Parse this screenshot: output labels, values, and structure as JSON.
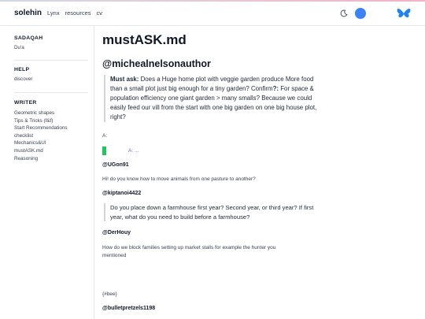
{
  "nav": {
    "brand": "solehin",
    "links": [
      "Lynx",
      "resources",
      "cv"
    ],
    "icons": {
      "theme": "moon-icon",
      "bluesky": "bluesky-avatar",
      "butterfly": "bluesky-butterfly-icon"
    },
    "accent": "#3b82f6"
  },
  "sidebar": {
    "sections": [
      {
        "title": "SADAQAH",
        "items": [
          "Du'a"
        ]
      },
      {
        "title": "HELP",
        "items": [
          "discover"
        ]
      },
      {
        "title": "WRITER",
        "items": [
          "Geometric shapes",
          "Tips & Tricks (f&f)",
          "Start Recommendations",
          "checklist",
          "Mechanics&UI",
          "mustASK.md",
          "Reasoning"
        ]
      }
    ]
  },
  "main": {
    "title": "mustASK.md",
    "handle": "@michealnelsonauthor",
    "quote1": {
      "strong": "Must ask:",
      "text": " Does a Huge home plot with veggie garden produce More food than a small plot just big enough for a tiny garden? Confirm",
      "strong2": "?:",
      "text2": " For space & population efficiency one giant garden > many smalls? Because we could easily feed our vill from the start with one big garden on one big house plot, right?"
    },
    "a_label": "A:",
    "a_link": "A: ...",
    "user1": "@UGon91",
    "text1": "Hi! do you know how to move animals from one pasture to another?",
    "user2": "@kiptanoi4422",
    "quote2": "Do you place down a farmhouse first year? Second year, or third year? If first year, what do you need to build before a farmhouse?",
    "user3": "@DerHouy",
    "text3": "How do we block families setting up market stalls for example the hunter you mentioned",
    "tag": "{#bee}",
    "user4": "@bulletpretzels1198"
  }
}
